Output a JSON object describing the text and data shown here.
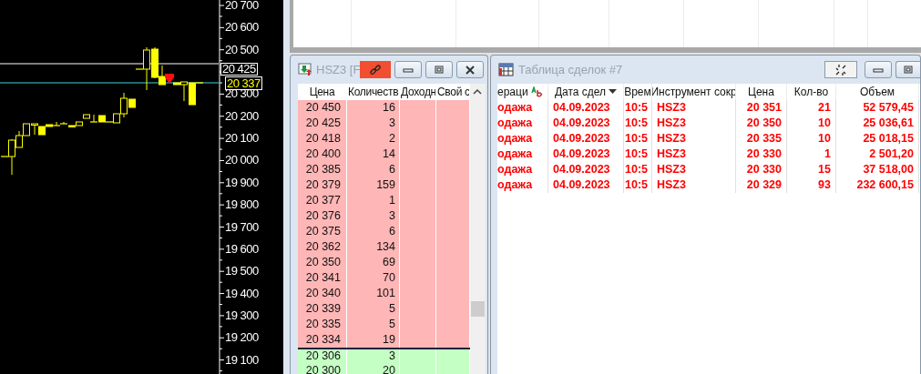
{
  "chart": {
    "price_axis": [
      "20 700",
      "20 600",
      "20 500",
      "20 300",
      "20 200",
      "20 100",
      "20 000",
      "19 900",
      "19 800",
      "19 700",
      "19 600",
      "19 500",
      "19 400",
      "19 300",
      "19 200",
      "19 100"
    ],
    "price_tags": [
      {
        "kind": "level",
        "text": "20 425"
      },
      {
        "kind": "last",
        "text": "20 337"
      }
    ]
  },
  "order_book": {
    "title": "HSZ3 [F",
    "columns": [
      "Цена",
      "Количеств",
      "Доходн",
      "Свой с"
    ],
    "rows": [
      {
        "price": "20 450",
        "qty": "16",
        "kind": "ask"
      },
      {
        "price": "20 425",
        "qty": "3",
        "kind": "ask"
      },
      {
        "price": "20 418",
        "qty": "2",
        "kind": "ask"
      },
      {
        "price": "20 400",
        "qty": "14",
        "kind": "ask"
      },
      {
        "price": "20 385",
        "qty": "6",
        "kind": "ask"
      },
      {
        "price": "20 379",
        "qty": "159",
        "kind": "ask"
      },
      {
        "price": "20 377",
        "qty": "1",
        "kind": "ask"
      },
      {
        "price": "20 376",
        "qty": "3",
        "kind": "ask"
      },
      {
        "price": "20 375",
        "qty": "6",
        "kind": "ask"
      },
      {
        "price": "20 362",
        "qty": "134",
        "kind": "ask"
      },
      {
        "price": "20 350",
        "qty": "69",
        "kind": "ask"
      },
      {
        "price": "20 341",
        "qty": "70",
        "kind": "ask"
      },
      {
        "price": "20 340",
        "qty": "101",
        "kind": "ask"
      },
      {
        "price": "20 339",
        "qty": "5",
        "kind": "ask"
      },
      {
        "price": "20 335",
        "qty": "5",
        "kind": "ask"
      },
      {
        "price": "20 334",
        "qty": "19",
        "kind": "ask"
      },
      {
        "price": "20 306",
        "qty": "3",
        "kind": "bid"
      },
      {
        "price": "20 300",
        "qty": "20",
        "kind": "bid"
      }
    ]
  },
  "trades": {
    "title": "Таблица сделок #7",
    "columns": [
      {
        "label": "ераци",
        "sorted": false,
        "filter": true
      },
      {
        "label": "Дата сдел",
        "sorted": true,
        "filter": false
      },
      {
        "label": "Врем",
        "sorted": false,
        "filter": false
      },
      {
        "label": "Инструмент сокр",
        "sorted": false,
        "filter": false
      },
      {
        "label": "Цена",
        "sorted": false,
        "filter": false
      },
      {
        "label": "Кол-во",
        "sorted": false,
        "filter": false
      },
      {
        "label": "Объем",
        "sorted": false,
        "filter": false
      }
    ],
    "rows": [
      {
        "kind": "sell",
        "cells": [
          "одажа",
          "04.09.2023",
          "10:5",
          "HSZ3",
          "20 351",
          "21",
          "52 579,45"
        ]
      },
      {
        "kind": "sell",
        "cells": [
          "одажа",
          "04.09.2023",
          "10:5",
          "HSZ3",
          "20 350",
          "10",
          "25 036,61"
        ]
      },
      {
        "kind": "sell",
        "cells": [
          "одажа",
          "04.09.2023",
          "10:5",
          "HSZ3",
          "20 335",
          "10",
          "25 018,15"
        ]
      },
      {
        "kind": "sell",
        "cells": [
          "одажа",
          "04.09.2023",
          "10:5",
          "HSZ3",
          "20 330",
          "1",
          "2 501,20"
        ]
      },
      {
        "kind": "sell",
        "cells": [
          "одажа",
          "04.09.2023",
          "10:5",
          "HSZ3",
          "20 330",
          "15",
          "37 518,00"
        ]
      },
      {
        "kind": "sell",
        "cells": [
          "одажа",
          "04.09.2023",
          "10:5",
          "HSZ3",
          "20 329",
          "93",
          "232 600,15"
        ]
      }
    ]
  }
}
